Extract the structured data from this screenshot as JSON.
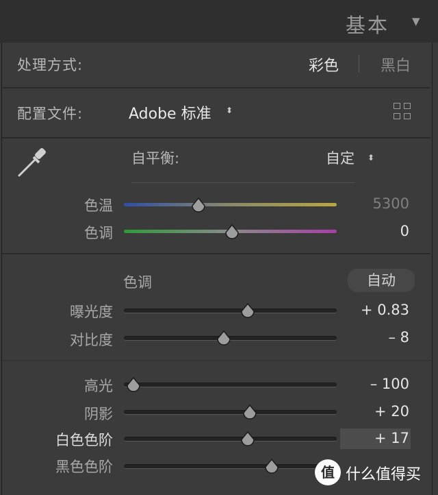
{
  "header": {
    "title": "基本",
    "collapse_icon": "triangle-down-icon"
  },
  "treatment": {
    "label": "处理方式:",
    "color": "彩色",
    "bw": "黑白"
  },
  "profile": {
    "label": "配置文件:",
    "value": "Adobe 标准",
    "browser_icon": "grid-icon"
  },
  "white_balance": {
    "picker_icon": "eyedropper-icon",
    "label": "自平衡:",
    "value": "自定",
    "sliders": [
      {
        "label": "色温",
        "value": "5300",
        "position": 0.35
      },
      {
        "label": "色调",
        "value": "0",
        "position": 0.5
      }
    ]
  },
  "tone": {
    "title": "色调",
    "auto_label": "自动",
    "sliders": [
      {
        "label": "曝光度",
        "value": "+ 0.83",
        "position": 0.58
      },
      {
        "label": "对比度",
        "value": "– 8",
        "position": 0.47
      }
    ]
  },
  "presence": {
    "sliders": [
      {
        "label": "高光",
        "value": "– 100",
        "position": 0.0
      },
      {
        "label": "阴影",
        "value": "+ 20",
        "position": 0.58
      },
      {
        "label": "白色色阶",
        "value": "+ 17",
        "position": 0.58
      },
      {
        "label": "黑色色阶",
        "value": "",
        "position": 0.69
      }
    ]
  },
  "watermark": {
    "badge": "值",
    "text": "什么值得买"
  }
}
